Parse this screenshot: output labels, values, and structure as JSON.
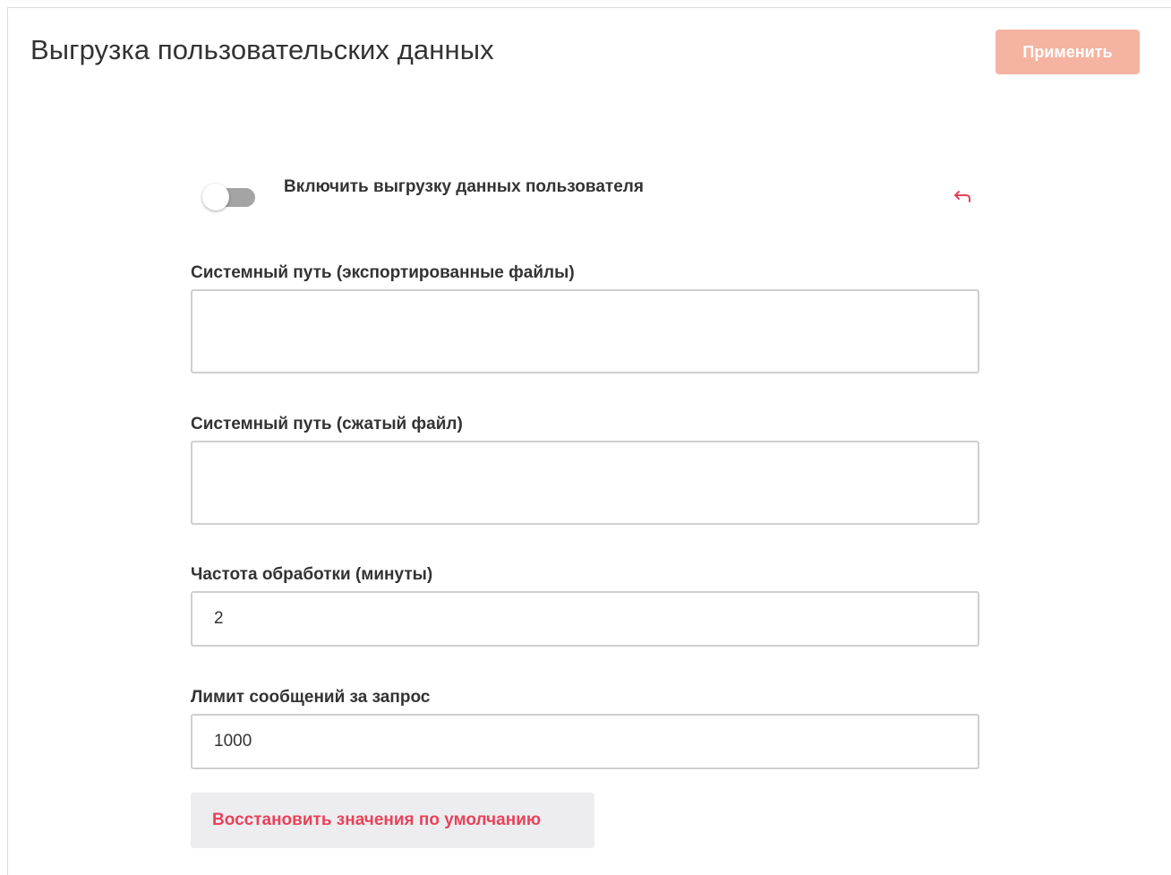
{
  "header": {
    "title": "Выгрузка пользовательских данных",
    "apply_label": "Применить",
    "apply_color": "#f5b3a1"
  },
  "toggle": {
    "label": "Включить выгрузку данных пользователя",
    "enabled": false,
    "revert_icon": "undo-arrow-icon",
    "revert_icon_color": "#e8425a"
  },
  "fields": [
    {
      "label": "Системный путь (экспортированные файлы)",
      "value": ""
    },
    {
      "label": "Системный путь (сжатый файл)",
      "value": ""
    },
    {
      "label": "Частота обработки (минуты)",
      "value": "2"
    },
    {
      "label": "Лимит сообщений за запрос",
      "value": "1000"
    }
  ],
  "reset": {
    "label": "Восстановить значения по умолчанию",
    "color": "#e8425a"
  }
}
